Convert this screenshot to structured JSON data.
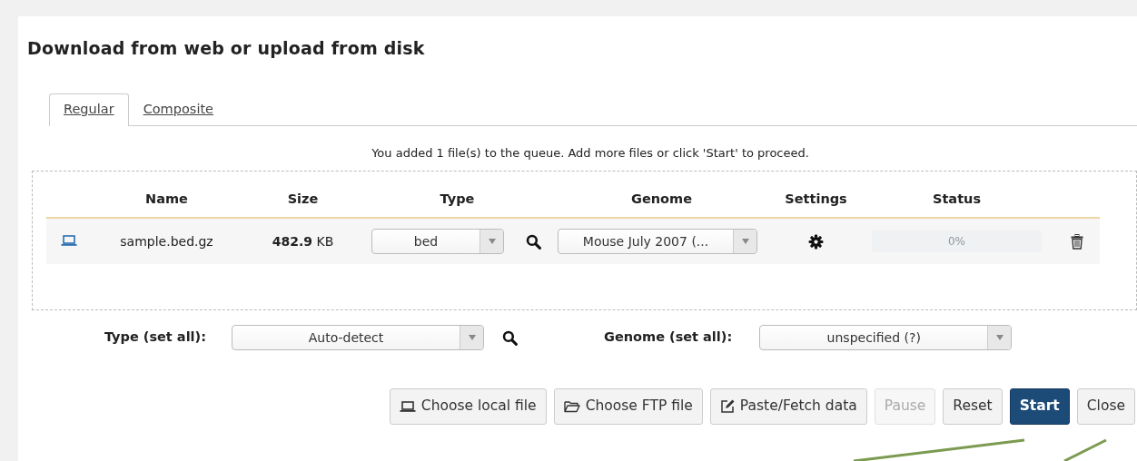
{
  "title": "Download from web or upload from disk",
  "tabs": [
    {
      "label": "Regular",
      "selected": true
    },
    {
      "label": "Composite",
      "selected": false
    }
  ],
  "queue_message": "You added 1 file(s) to the queue. Add more files or click 'Start' to proceed.",
  "table": {
    "columns": [
      "Name",
      "Size",
      "Type",
      "Genome",
      "Settings",
      "Status"
    ],
    "rows": [
      {
        "name": "sample.bed.gz",
        "size": "**482.9** KB",
        "type": "bed",
        "genome": "Mouse July 2007 (...",
        "status": {
          "level": 0,
          "reading": "0%"
        }
      }
    ]
  },
  "set_all": [
    {
      "kind": "type",
      "label": "Type (set all):",
      "value": "Auto-detect"
    },
    {
      "kind": "genome",
      "label": "Genome (set all):",
      "value": "unspecified (?)"
    }
  ],
  "buttons": [
    {
      "label": "Choose local file",
      "disabled": false,
      "primary": false
    },
    {
      "label": "Choose FTP file",
      "disabled": false,
      "primary": false
    },
    {
      "label": "Paste/Fetch data",
      "disabled": false,
      "primary": false
    },
    {
      "label": "Pause",
      "disabled": true,
      "primary": false
    },
    {
      "label": "Reset",
      "disabled": false,
      "primary": false
    },
    {
      "label": "Start",
      "disabled": false,
      "primary": true
    },
    {
      "label": "Close",
      "disabled": false,
      "primary": false
    }
  ]
}
